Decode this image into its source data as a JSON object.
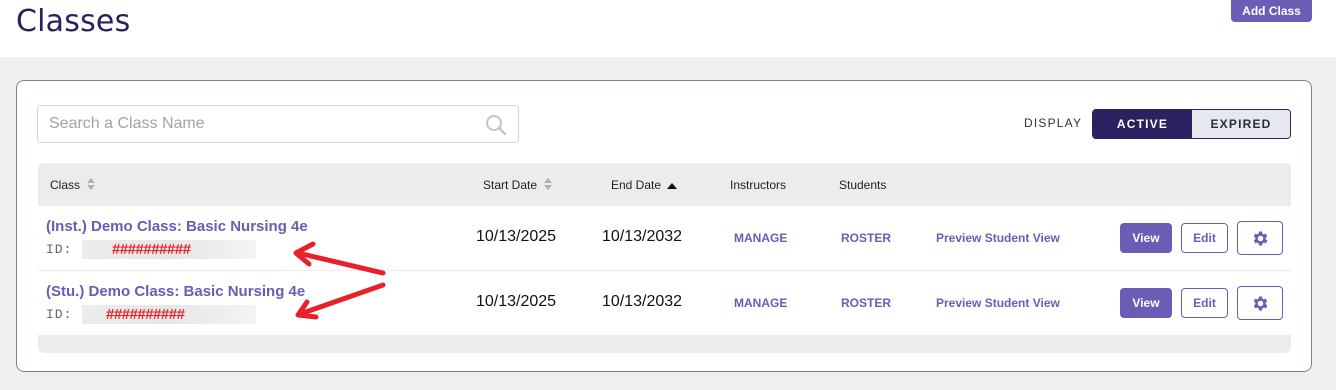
{
  "header": {
    "title": "Classes",
    "add_button": "Add Class"
  },
  "search": {
    "placeholder": "Search a Class Name",
    "value": ""
  },
  "display": {
    "label": "DISPLAY",
    "options": [
      "ACTIVE",
      "EXPIRED"
    ],
    "selected": "ACTIVE"
  },
  "table": {
    "columns": [
      "Class",
      "Start Date",
      "End Date",
      "Instructors",
      "Students"
    ],
    "sort": {
      "column": "End Date",
      "direction": "ascending"
    },
    "rows": [
      {
        "name": "(Inst.) Demo Class: Basic Nursing 4e",
        "id_label": "ID:",
        "id_value": "##########",
        "start": "10/13/2025",
        "end": "10/13/2032",
        "instructors": "MANAGE",
        "students": "ROSTER",
        "preview": "Preview Student View",
        "view": "View",
        "edit": "Edit"
      },
      {
        "name": "(Stu.) Demo Class: Basic Nursing 4e",
        "id_label": "ID:",
        "id_value": "##########",
        "start": "10/13/2025",
        "end": "10/13/2032",
        "instructors": "MANAGE",
        "students": "ROSTER",
        "preview": "Preview Student View",
        "view": "View",
        "edit": "Edit"
      }
    ]
  },
  "colors": {
    "primary": "#6b5cb5",
    "dark": "#2b2160",
    "annotation": "#e8202a"
  },
  "icons": {
    "search": "search-icon",
    "gear": "gear-icon",
    "sort": "sort-icon",
    "sort_up": "sort-ascending-icon"
  }
}
